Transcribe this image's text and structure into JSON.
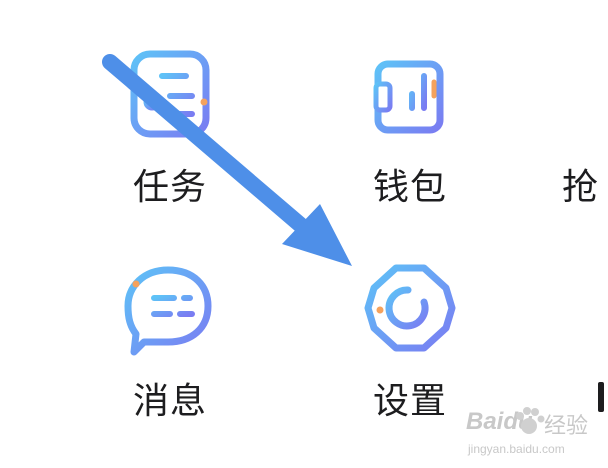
{
  "grid": {
    "tasks": {
      "label": "任务",
      "icon": "task-icon"
    },
    "wallet": {
      "label": "钱包",
      "icon": "wallet-icon"
    },
    "messages": {
      "label": "消息",
      "icon": "message-icon"
    },
    "settings": {
      "label": "设置",
      "icon": "settings-icon"
    },
    "partial": {
      "label": "抢"
    }
  },
  "colors": {
    "icon_gradient_start": "#5EC2F7",
    "icon_gradient_end": "#7A7CF2",
    "accent_orange": "#F5A25D",
    "arrow": "#4E8FE8",
    "text": "#1D1D1F"
  },
  "watermark": {
    "brand": "Baidu",
    "cn": "经验",
    "url": "jingyan.baidu.com"
  }
}
